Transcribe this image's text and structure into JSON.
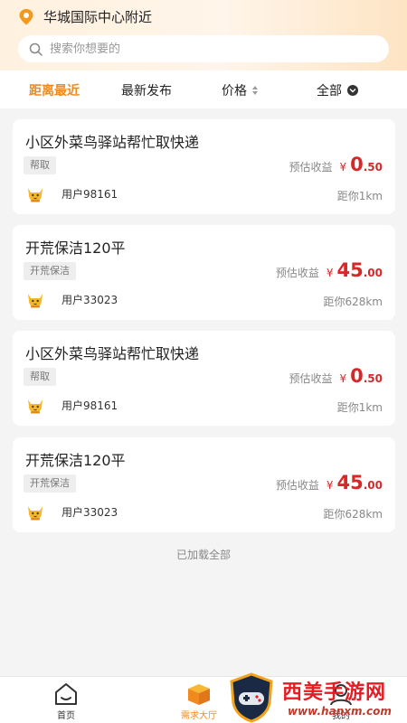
{
  "location": {
    "text": "华城国际中心附近"
  },
  "search": {
    "placeholder": "搜索你想要的"
  },
  "filters": [
    {
      "label": "距离最近",
      "active": true
    },
    {
      "label": "最新发布",
      "active": false
    },
    {
      "label": "价格",
      "active": false
    },
    {
      "label": "全部",
      "active": false
    }
  ],
  "earning_label": "预估收益",
  "currency": "¥",
  "tasks": [
    {
      "title": "小区外菜鸟驿站帮忙取快递",
      "tag": "帮取",
      "price_int": "0",
      "price_dec": ".50",
      "user": "用户98161",
      "distance": "距你1km"
    },
    {
      "title": "开荒保洁120平",
      "tag": "开荒保洁",
      "price_int": "45",
      "price_dec": ".00",
      "user": "用户33023",
      "distance": "距你628km"
    },
    {
      "title": "小区外菜鸟驿站帮忙取快递",
      "tag": "帮取",
      "price_int": "0",
      "price_dec": ".50",
      "user": "用户98161",
      "distance": "距你1km"
    },
    {
      "title": "开荒保洁120平",
      "tag": "开荒保洁",
      "price_int": "45",
      "price_dec": ".00",
      "user": "用户33023",
      "distance": "距你628km"
    }
  ],
  "footer_note": "已加载全部",
  "tabbar": [
    {
      "label": "首页",
      "icon": "home-icon"
    },
    {
      "label": "需求大厅",
      "icon": "box-icon"
    },
    {
      "label": "我的",
      "icon": "user-icon"
    }
  ],
  "watermark": {
    "title": "西美手游网",
    "url": "www.hanxm.com"
  },
  "colors": {
    "accent": "#f08a1c",
    "price": "#d62828",
    "background": "#f4f4f4"
  }
}
